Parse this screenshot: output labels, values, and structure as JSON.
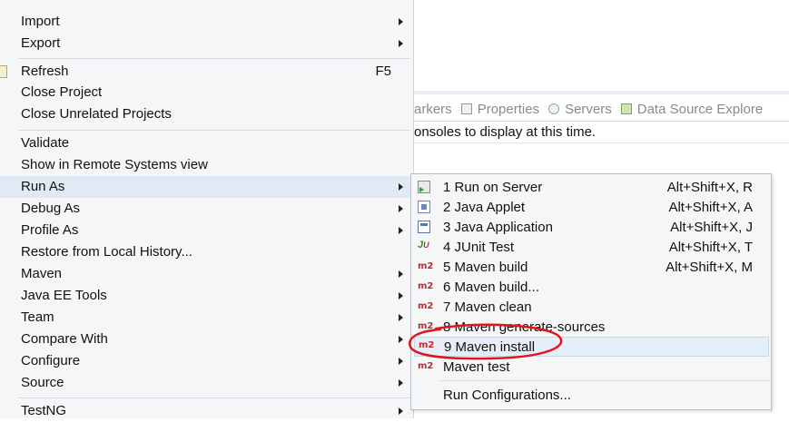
{
  "background": {
    "view_tabs": [
      {
        "label": "Markers",
        "icon": "markers-icon"
      },
      {
        "label": "Properties",
        "icon": "properties-icon"
      },
      {
        "label": "Servers",
        "icon": "servers-icon"
      },
      {
        "label": "Data Source Explore",
        "icon": "data-source-icon"
      }
    ],
    "view_tabs_visible_first": "arkers",
    "console_message": "onsoles to display at this time."
  },
  "context_menu": {
    "items": [
      {
        "label": "Import",
        "submenu": true
      },
      {
        "label": "Export",
        "submenu": true
      },
      {
        "label": "Refresh",
        "accelerator": "F5",
        "icon": "refresh-icon"
      },
      {
        "label": "Close Project"
      },
      {
        "label": "Close Unrelated Projects"
      },
      {
        "label": "Validate"
      },
      {
        "label": "Show in Remote Systems view"
      },
      {
        "label": "Run As",
        "submenu": true,
        "highlighted": true
      },
      {
        "label": "Debug As",
        "submenu": true
      },
      {
        "label": "Profile As",
        "submenu": true
      },
      {
        "label": "Restore from Local History..."
      },
      {
        "label": "Maven",
        "submenu": true
      },
      {
        "label": "Java EE Tools",
        "submenu": true
      },
      {
        "label": "Team",
        "submenu": true
      },
      {
        "label": "Compare With",
        "submenu": true
      },
      {
        "label": "Configure",
        "submenu": true
      },
      {
        "label": "Source",
        "submenu": true
      },
      {
        "label": "TestNG",
        "submenu": true
      }
    ]
  },
  "run_as_submenu": {
    "items": [
      {
        "label": "1 Run on Server",
        "accelerator": "Alt+Shift+X, R",
        "icon": "run-on-server-icon"
      },
      {
        "label": "2 Java Applet",
        "accelerator": "Alt+Shift+X, A",
        "icon": "java-applet-icon"
      },
      {
        "label": "3 Java Application",
        "accelerator": "Alt+Shift+X, J",
        "icon": "java-application-icon"
      },
      {
        "label": "4 JUnit Test",
        "accelerator": "Alt+Shift+X, T",
        "icon": "junit-icon"
      },
      {
        "label": "5 Maven build",
        "accelerator": "Alt+Shift+X, M",
        "icon": "maven-m2-icon"
      },
      {
        "label": "6 Maven build...",
        "icon": "maven-m2-icon"
      },
      {
        "label": "7 Maven clean",
        "icon": "maven-m2-icon"
      },
      {
        "label": "8 Maven generate-sources",
        "icon": "maven-m2-icon"
      },
      {
        "label": "9 Maven install",
        "icon": "maven-m2-icon",
        "highlighted": true
      },
      {
        "label": "Maven test",
        "icon": "maven-m2-icon"
      },
      {
        "label": "Run Configurations..."
      }
    ],
    "icon_text_m2": "m2",
    "icon_text_junit": "J",
    "icon_text_junit_sub": "U"
  },
  "colors": {
    "menu_bg": "#f5f6f7",
    "highlight": "#e1e9f5",
    "maven_red": "#c3282e",
    "annotation_red": "#e0141e"
  }
}
